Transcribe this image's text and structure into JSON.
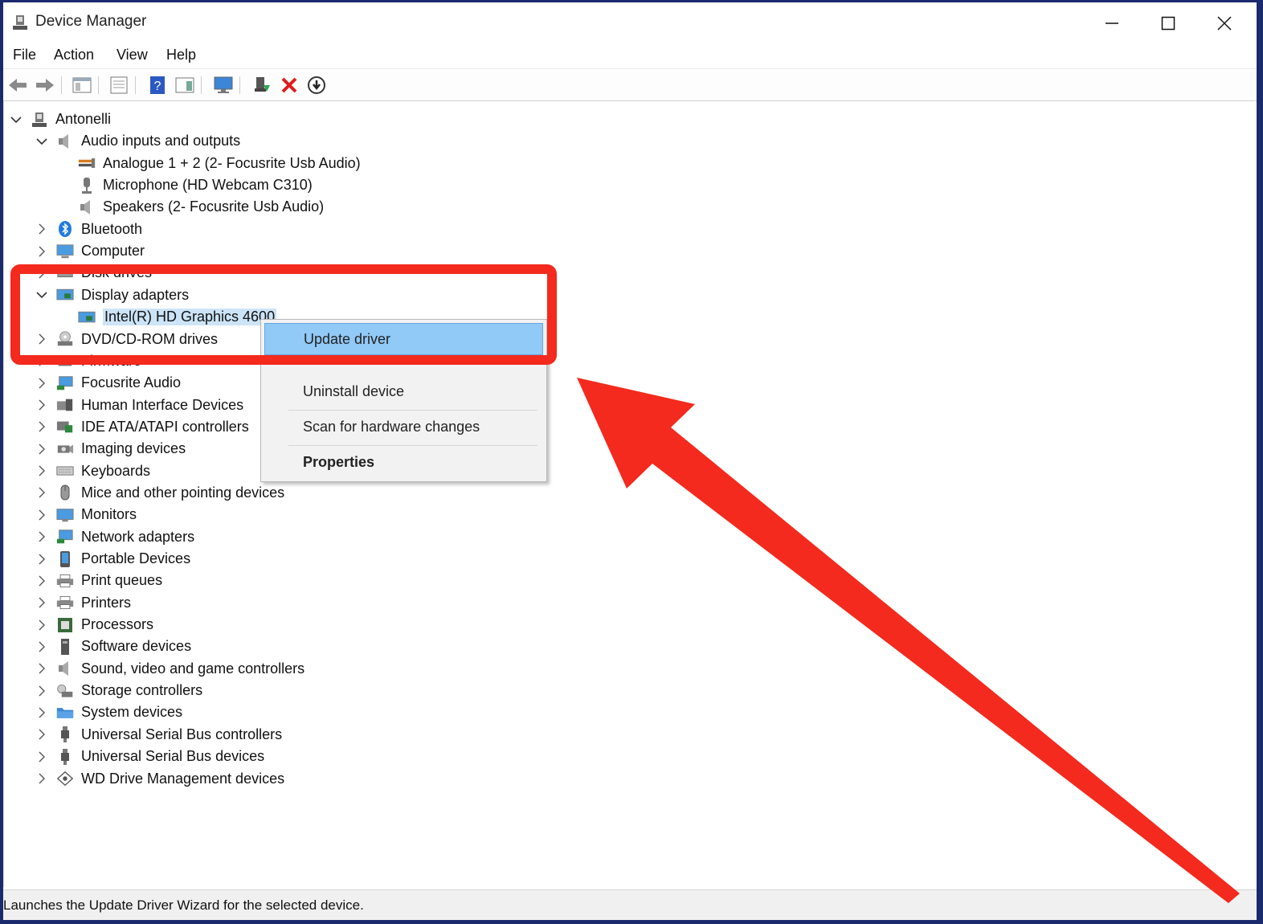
{
  "window": {
    "title": "Device Manager"
  },
  "menu": [
    "File",
    "Action",
    "View",
    "Help"
  ],
  "toolbar": [
    {
      "icon": "back-arrow-icon"
    },
    {
      "icon": "forward-arrow-icon"
    },
    {
      "icon": "show-hide-console-tree-icon"
    },
    {
      "icon": "properties-icon"
    },
    {
      "icon": "help-icon"
    },
    {
      "icon": "show-action-pane-icon"
    },
    {
      "icon": "scan-hardware-monitor-icon"
    },
    {
      "icon": "update-driver-icon"
    },
    {
      "icon": "uninstall-x-icon"
    },
    {
      "icon": "download-circle-icon"
    }
  ],
  "tree": {
    "root": "Antonelli",
    "items": [
      {
        "label": "Audio inputs and outputs",
        "expanded": true,
        "icon": "speaker-icon"
      },
      {
        "label": "Analogue 1 + 2 (2- Focusrite Usb Audio)",
        "child": true,
        "icon": "audio-line-icon"
      },
      {
        "label": "Microphone (HD Webcam C310)",
        "child": true,
        "icon": "microphone-icon"
      },
      {
        "label": "Speakers (2- Focusrite Usb Audio)",
        "child": true,
        "icon": "speaker-icon"
      },
      {
        "label": "Bluetooth",
        "icon": "bluetooth-icon"
      },
      {
        "label": "Computer",
        "icon": "computer-icon"
      },
      {
        "label": "Disk drives",
        "icon": "disk-icon"
      },
      {
        "label": "Display adapters",
        "expanded": true,
        "icon": "display-adapter-icon"
      },
      {
        "label": "Intel(R) HD Graphics 4600",
        "child": true,
        "selected": true,
        "icon": "display-adapter-icon"
      },
      {
        "label": "DVD/CD-ROM drives",
        "icon": "dvd-drive-icon"
      },
      {
        "label": "Firmware",
        "icon": "firmware-icon"
      },
      {
        "label": "Focusrite Audio",
        "icon": "network-icon"
      },
      {
        "label": "Human Interface Devices",
        "icon": "hid-icon"
      },
      {
        "label": "IDE ATA/ATAPI controllers",
        "icon": "ide-controller-icon"
      },
      {
        "label": "Imaging devices",
        "icon": "camera-icon"
      },
      {
        "label": "Keyboards",
        "icon": "keyboard-icon"
      },
      {
        "label": "Mice and other pointing devices",
        "icon": "mouse-icon"
      },
      {
        "label": "Monitors",
        "icon": "monitor-icon"
      },
      {
        "label": "Network adapters",
        "icon": "network-icon"
      },
      {
        "label": "Portable Devices",
        "icon": "portable-device-icon"
      },
      {
        "label": "Print queues",
        "icon": "printer-icon"
      },
      {
        "label": "Printers",
        "icon": "printer-icon"
      },
      {
        "label": "Processors",
        "icon": "processor-icon"
      },
      {
        "label": "Software devices",
        "icon": "software-device-icon"
      },
      {
        "label": "Sound, video and game controllers",
        "icon": "speaker-icon"
      },
      {
        "label": "Storage controllers",
        "icon": "storage-controller-icon"
      },
      {
        "label": "System devices",
        "icon": "system-folder-icon"
      },
      {
        "label": "Universal Serial Bus controllers",
        "icon": "usb-icon"
      },
      {
        "label": "Universal Serial Bus devices",
        "icon": "usb-icon"
      },
      {
        "label": "WD Drive Management devices",
        "icon": "wd-drive-icon"
      }
    ]
  },
  "context_menu": {
    "items": [
      "Update driver",
      "Uninstall device",
      "Scan for hardware changes",
      "Properties"
    ]
  },
  "status": "Launches the Update Driver Wizard for the selected device.",
  "colors": {
    "highlight": "#f32a1d",
    "selection": "#cce4f7",
    "menu_hover": "#91c9f7"
  }
}
